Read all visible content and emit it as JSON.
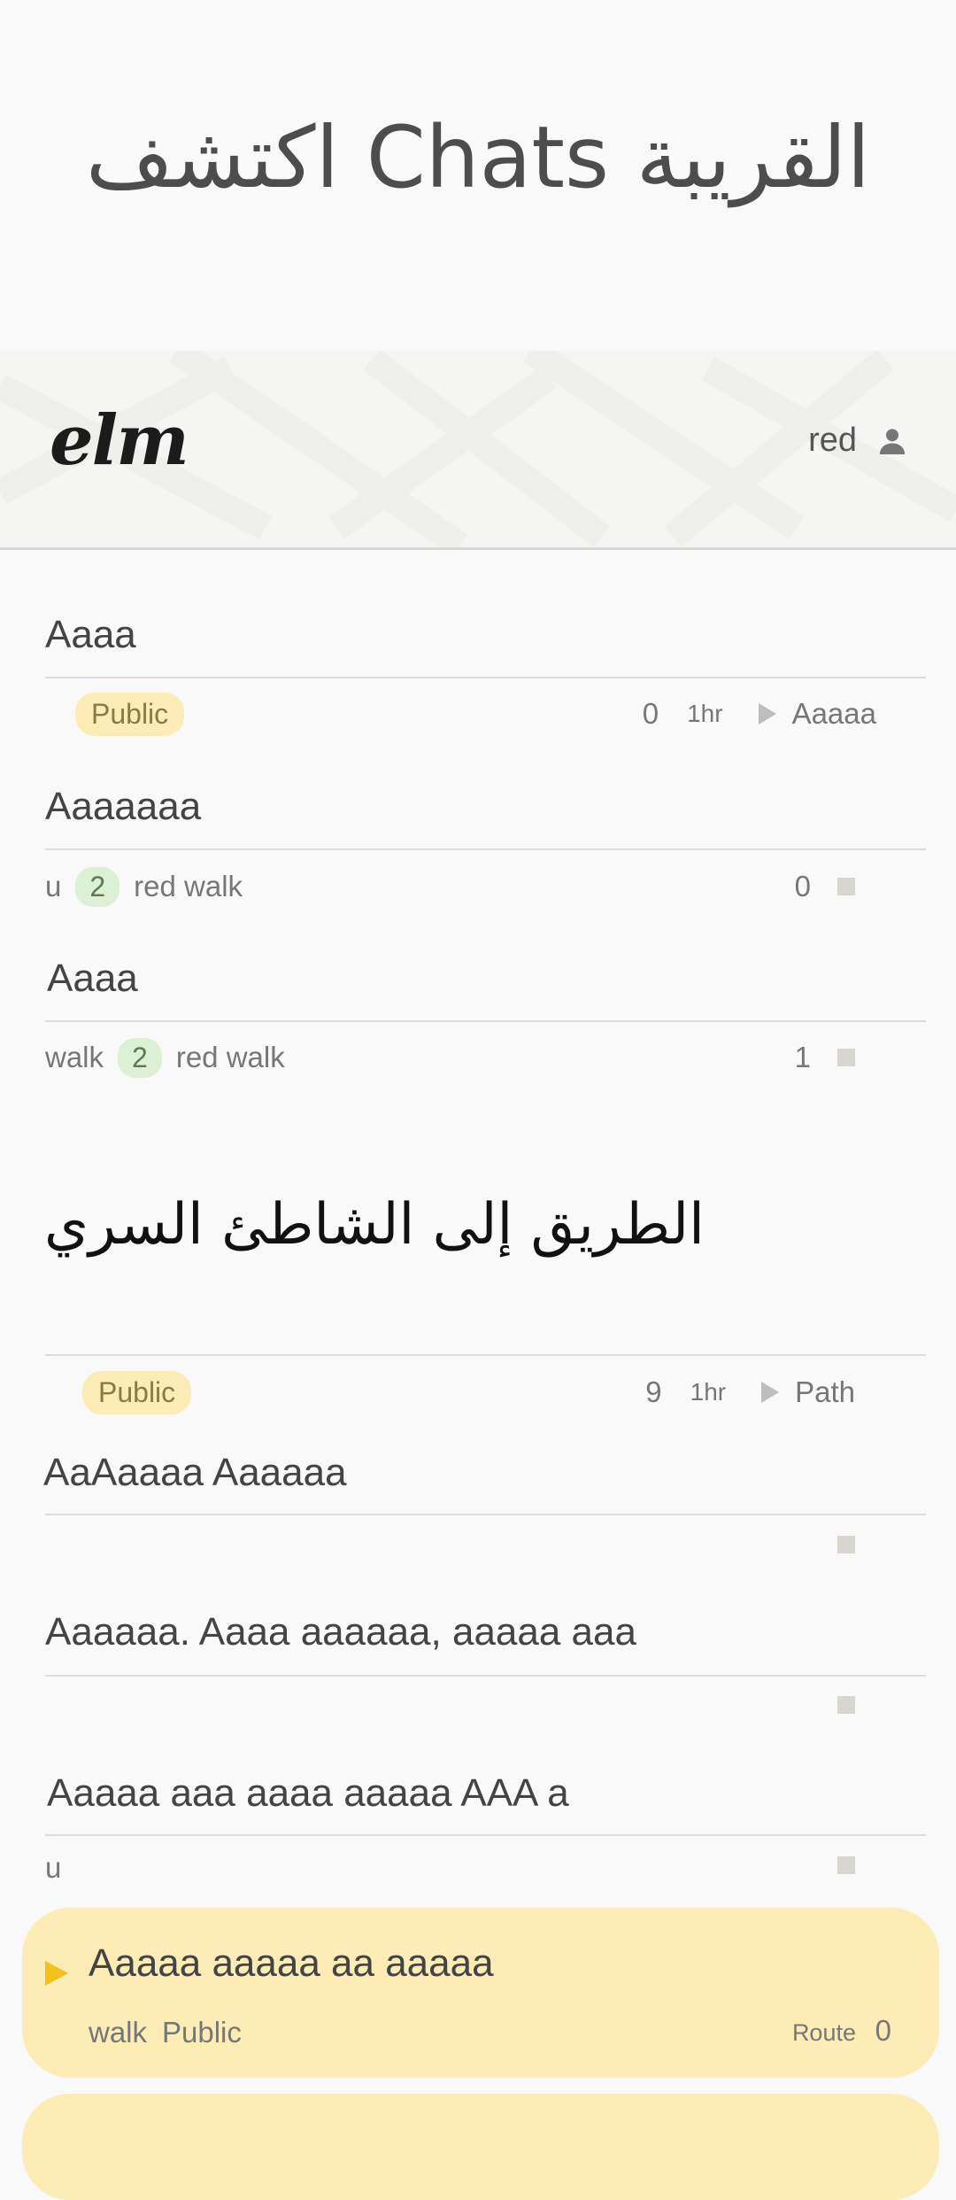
{
  "hero": {
    "title": "اكتشف Chats القريبة"
  },
  "header": {
    "logo": "elm",
    "user_name": "red",
    "user_icon": "person-icon"
  },
  "items": [
    {
      "title": "Aaaa",
      "visibility": "Public",
      "count": "0",
      "time": "1hr",
      "target": "Aaaaa"
    },
    {
      "title": "Aaaaaaa",
      "prefix": "u",
      "badge": "2",
      "people": "red walk",
      "count": "0"
    },
    {
      "title": "Aaaa",
      "prefix": "walk",
      "badge": "2",
      "people": "red walk",
      "count": "1"
    }
  ],
  "section": {
    "heading": "الطريق إلى الشاطئ السري",
    "visibility": "Public",
    "count": "9",
    "time": "1hr",
    "target": "Path"
  },
  "section_items": [
    {
      "title": "AaAaaaa Aaaaaa",
      "sub": ""
    },
    {
      "title": "Aaaaaa. Aaaa aaaaaa, aaaaa aaa",
      "sub": ""
    },
    {
      "title": "Aaaaa aaa aaaa aaaaa AAA a",
      "sub": "u"
    }
  ],
  "card": {
    "title": "Aaaaa aaaaa aa aaaaa",
    "user": "walk",
    "visibility": "Public",
    "type": "Route",
    "count": "0"
  },
  "colors": {
    "accent": "#fdecb6",
    "badge_green": "#ddefd4",
    "play": "#f2c21b"
  }
}
